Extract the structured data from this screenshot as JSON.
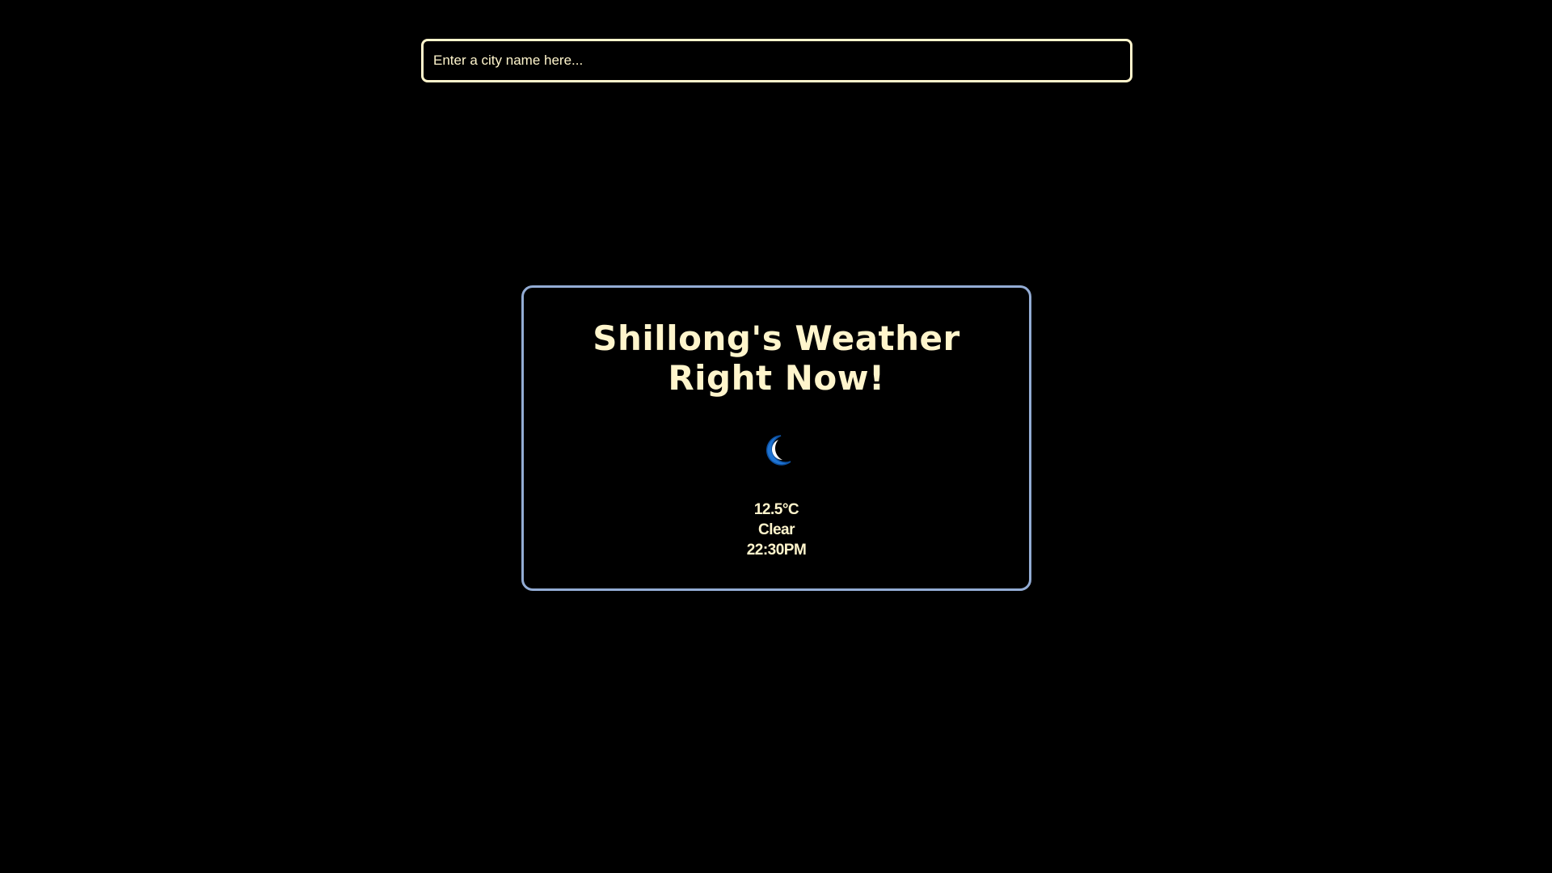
{
  "search": {
    "placeholder": "Enter a city name here...",
    "value": ""
  },
  "weather": {
    "title": "Shillong's Weather Right Now!",
    "icon": "moon-icon",
    "temperature": "12.5°C",
    "condition": "Clear",
    "time": "22:30PM"
  },
  "colors": {
    "background": "#000000",
    "text": "#fff5cc",
    "card_border": "#93acd4",
    "icon": "#1e73d2"
  }
}
